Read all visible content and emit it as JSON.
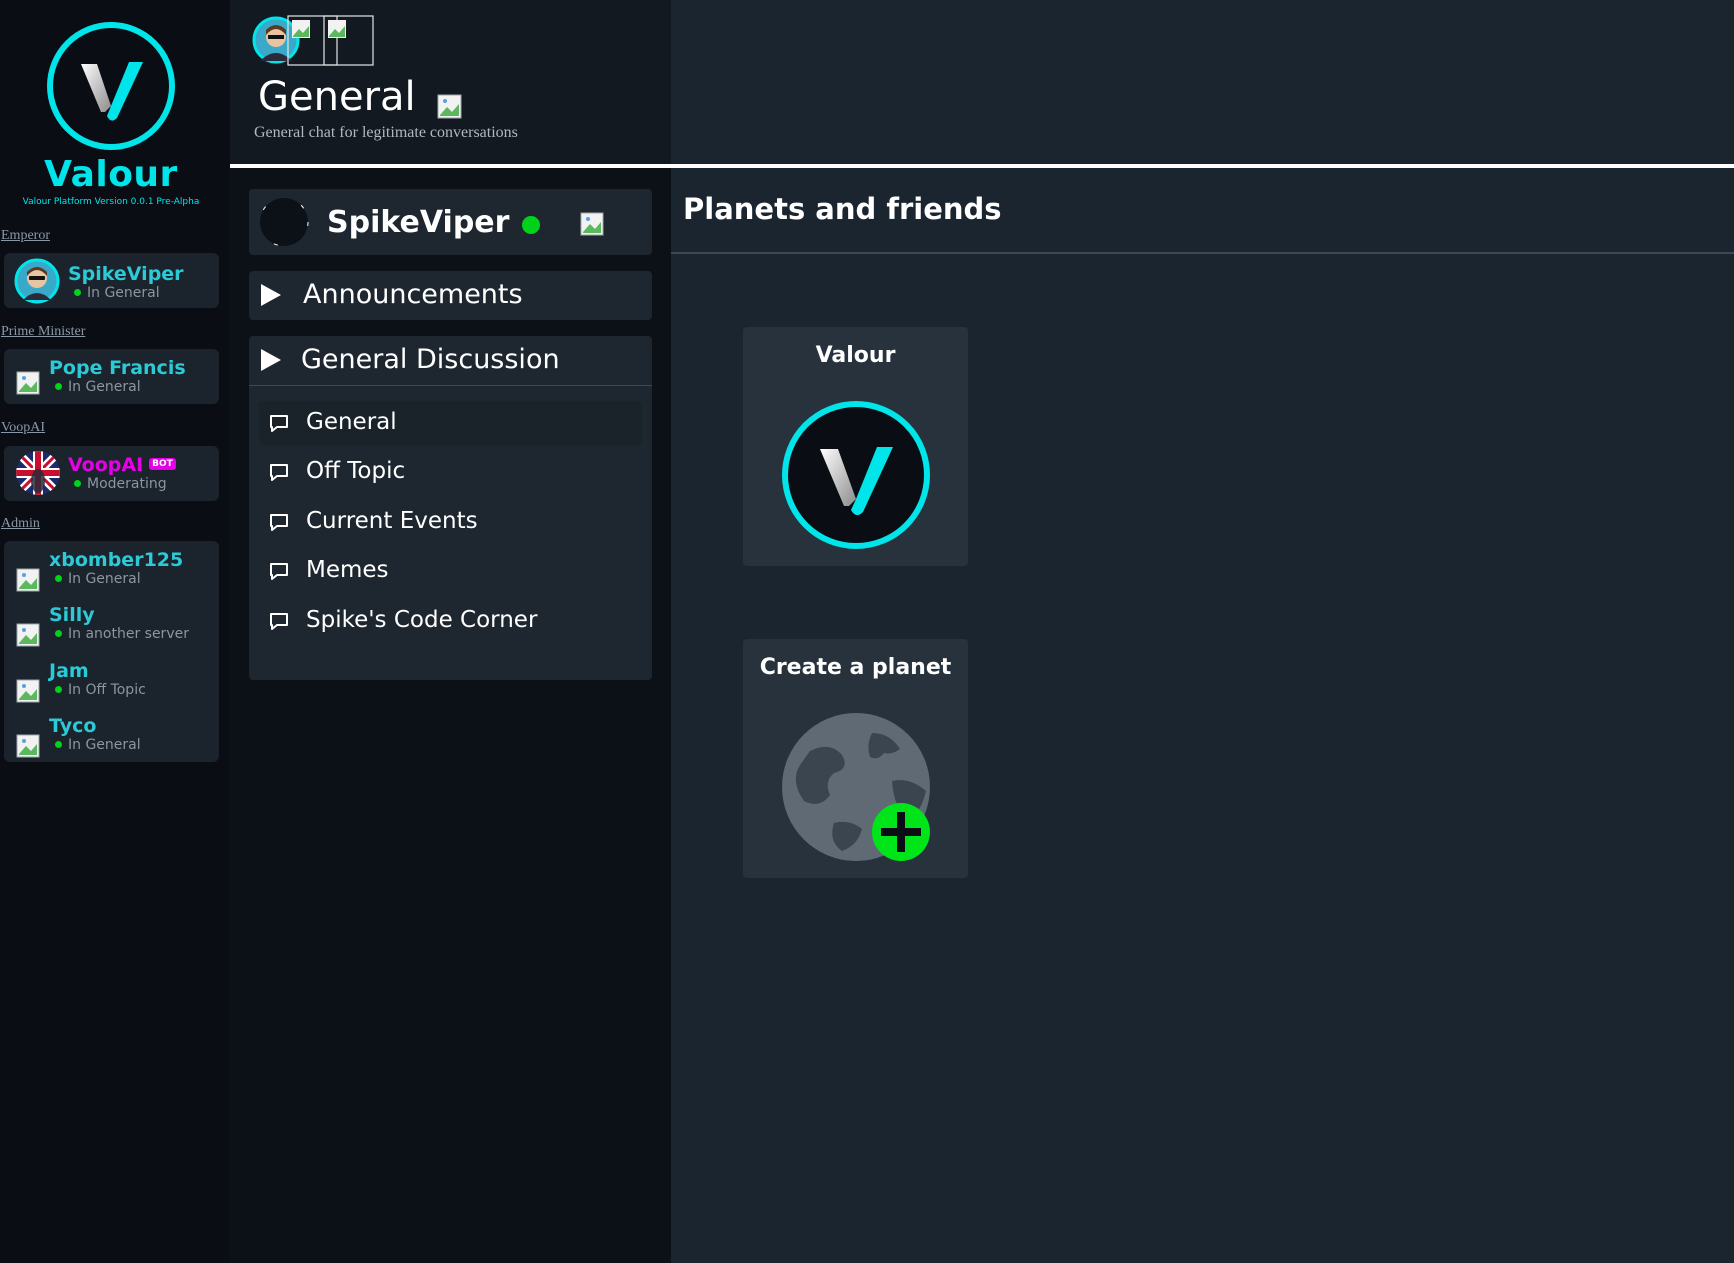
{
  "brand": {
    "name": "Valour",
    "version": "Valour Platform Version 0.0.1 Pre-Alpha",
    "accent": "#00e5e9"
  },
  "roles": [
    {
      "label": "Emperor",
      "members": [
        {
          "name": "SpikeViper",
          "status": "In General",
          "avatar": "photo"
        }
      ]
    },
    {
      "label": "Prime Minister",
      "members": [
        {
          "name": "Pope Francis",
          "status": "In General",
          "avatar": "broken-image-icon"
        }
      ]
    },
    {
      "label": "VoopAI",
      "members": [
        {
          "name": "VoopAI",
          "badge": "BOT",
          "status": "Moderating",
          "avatar": "flag",
          "name_color": "#e600e6"
        }
      ]
    },
    {
      "label": "Admin",
      "members": [
        {
          "name": "xbomber125",
          "status": "In General",
          "avatar": "broken-image-icon"
        },
        {
          "name": "Silly",
          "status": "In another server",
          "avatar": "broken-image-icon"
        },
        {
          "name": "Jam",
          "status": "In Off Topic",
          "avatar": "broken-image-icon"
        },
        {
          "name": "Tyco",
          "status": "In General",
          "avatar": "broken-image-icon"
        }
      ]
    }
  ],
  "channel_header": {
    "title": "General",
    "description": "General chat for legitimate conversations"
  },
  "current_user": {
    "name": "SpikeViper",
    "online": true
  },
  "channel_groups": [
    {
      "title": "Announcements",
      "expanded": false,
      "channels": []
    },
    {
      "title": "General Discussion",
      "expanded": true,
      "channels": [
        "General",
        "Off Topic",
        "Current Events",
        "Memes",
        "Spike's Code Corner"
      ]
    }
  ],
  "main": {
    "title": "Planets and friends",
    "cards": [
      {
        "title": "Valour",
        "icon": "valour-logo-icon"
      },
      {
        "title": "Create a planet",
        "icon": "create-planet-icon"
      }
    ]
  },
  "colors": {
    "online": "#00d11a",
    "name": "#2cc9d6",
    "bot_badge": "#e600e6",
    "panel": "#1e2730"
  }
}
